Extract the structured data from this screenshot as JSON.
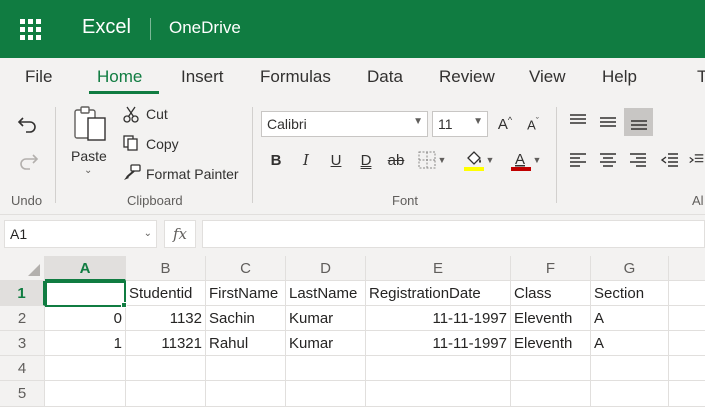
{
  "titlebar": {
    "app_name": "Excel",
    "location": "OneDrive",
    "color": "#107c41"
  },
  "tabs": [
    {
      "label": "File",
      "active": false
    },
    {
      "label": "Home",
      "active": true
    },
    {
      "label": "Insert",
      "active": false
    },
    {
      "label": "Formulas",
      "active": false
    },
    {
      "label": "Data",
      "active": false
    },
    {
      "label": "Review",
      "active": false
    },
    {
      "label": "View",
      "active": false
    },
    {
      "label": "Help",
      "active": false
    },
    {
      "label": "T",
      "active": false
    }
  ],
  "ribbon": {
    "undo_group": {
      "label": "Undo",
      "icons": [
        "undo-icon",
        "redo-icon"
      ]
    },
    "clipboard": {
      "label": "Clipboard",
      "paste": "Paste",
      "cut": "Cut",
      "copy": "Copy",
      "format_painter": "Format Painter"
    },
    "font": {
      "label": "Font",
      "font_name": "Calibri",
      "font_size": "11",
      "bold": "B",
      "italic": "I",
      "underline": "U",
      "double_underline": "D",
      "strikethrough": "ab",
      "font_color_letter": "A",
      "fill_color": "#ffff00",
      "font_color": "#c00000"
    },
    "alignment": {
      "label_partial": "Al"
    }
  },
  "formula_bar": {
    "name_box": "A1",
    "fx": "fx",
    "formula": ""
  },
  "sheet": {
    "columns": [
      "A",
      "B",
      "C",
      "D",
      "E",
      "F",
      "G"
    ],
    "rows": [
      "1",
      "2",
      "3",
      "4",
      "5"
    ],
    "cells": [
      [
        "",
        "Studentid",
        "FirstName",
        "LastName",
        "RegistrationDate",
        "Class",
        "Section"
      ],
      [
        "0",
        "1132",
        "Sachin",
        "Kumar",
        "11-11-1997",
        "Eleventh",
        "A"
      ],
      [
        "1",
        "11321",
        "Rahul",
        "Kumar",
        "11-11-1997",
        "Eleventh",
        "A"
      ],
      [
        "",
        "",
        "",
        "",
        "",
        "",
        ""
      ],
      [
        "",
        "",
        "",
        "",
        "",
        "",
        ""
      ]
    ],
    "selected_cell": "A1"
  }
}
